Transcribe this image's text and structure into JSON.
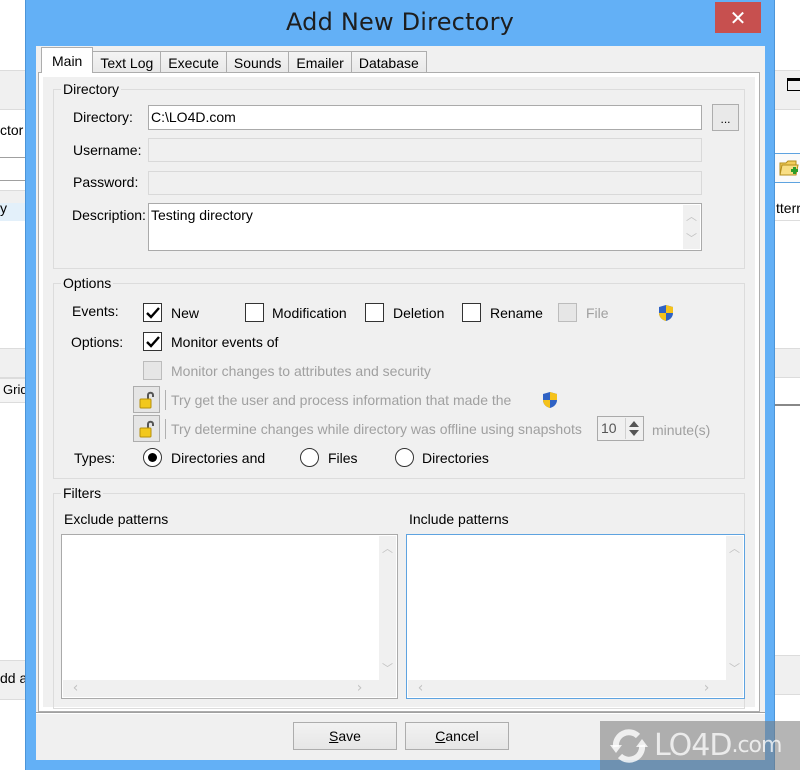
{
  "background_app": {
    "left_fragments": {
      "label_top": "ctor",
      "list_item": "y",
      "grid_button": "Grid",
      "bottom_text": "dd a"
    },
    "right_fragments": {
      "header_text": "tterr",
      "add_folder_icon": "folder-add-icon",
      "window_icon": "maximize-icon"
    }
  },
  "dialog": {
    "title": "Add New Directory",
    "close_label": "✕",
    "tabs": [
      {
        "label": "Main",
        "active": true
      },
      {
        "label": "Text Log",
        "active": false
      },
      {
        "label": "Execute",
        "active": false
      },
      {
        "label": "Sounds",
        "active": false
      },
      {
        "label": "Emailer",
        "active": false
      },
      {
        "label": "Database",
        "active": false
      }
    ],
    "directory_group": {
      "legend": "Directory",
      "directory_label": "Directory:",
      "directory_value": "C:\\LO4D.com",
      "browse_label": "...",
      "username_label": "Username:",
      "username_value": "",
      "password_label": "Password:",
      "password_value": "",
      "description_label": "Description:",
      "description_value": "Testing directory"
    },
    "options_group": {
      "legend": "Options",
      "events_label": "Events:",
      "events": [
        {
          "label": "New",
          "checked": true,
          "enabled": true
        },
        {
          "label": "Modification",
          "checked": false,
          "enabled": true
        },
        {
          "label": "Deletion",
          "checked": false,
          "enabled": true
        },
        {
          "label": "Rename",
          "checked": false,
          "enabled": true
        },
        {
          "label": "File",
          "checked": false,
          "enabled": false
        }
      ],
      "options_label": "Options:",
      "monitor_events_label": "Monitor events of",
      "monitor_events_checked": true,
      "monitor_attributes_label": "Monitor changes to attributes and security",
      "monitor_attributes_checked": false,
      "user_process_label": "Try get the user and process information that made the",
      "offline_snapshots_label": "Try determine changes while directory was offline using snapshots",
      "snapshot_interval_value": "10",
      "snapshot_interval_unit": "minute(s)",
      "types_label": "Types:",
      "types": [
        {
          "label": "Directories and",
          "selected": true
        },
        {
          "label": "Files",
          "selected": false
        },
        {
          "label": "Directories",
          "selected": false
        }
      ]
    },
    "filters_group": {
      "legend": "Filters",
      "exclude_label": "Exclude patterns",
      "include_label": "Include patterns",
      "exclude_value": "",
      "include_value": ""
    },
    "footer": {
      "save_label": "Save",
      "save_mnemonic": "S",
      "save_rest": "ave",
      "cancel_label": "Cancel",
      "cancel_mnemonic": "C",
      "cancel_rest": "ancel"
    }
  },
  "watermark": {
    "brand": "LO4D",
    "suffix": ".com"
  }
}
